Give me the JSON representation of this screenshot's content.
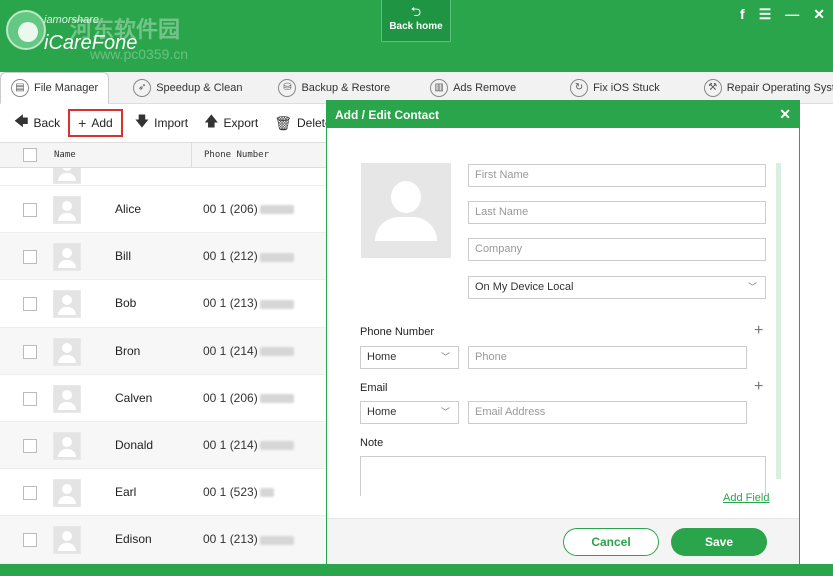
{
  "app": {
    "brand_small": "iamorshare",
    "brand_title": "iCareFone",
    "watermark": "河东软件园",
    "watermark_url": "www.pc0359.cn",
    "back_home_label": "Back home",
    "accent": "#2aa54b"
  },
  "nav": {
    "tabs": [
      {
        "label": "File Manager",
        "icon": "file-manager-icon"
      },
      {
        "label": "Speedup & Clean",
        "icon": "rocket-icon"
      },
      {
        "label": "Backup & Restore",
        "icon": "backup-icon"
      },
      {
        "label": "Ads Remove",
        "icon": "ads-icon"
      },
      {
        "label": "Fix iOS Stuck",
        "icon": "fix-icon"
      },
      {
        "label": "Repair Operating System",
        "icon": "wrench-icon"
      }
    ]
  },
  "toolbar": {
    "back": "Back",
    "add": "Add",
    "import": "Import",
    "export": "Export",
    "delete": "Delete"
  },
  "table": {
    "col_name": "Name",
    "col_phone": "Phone Number",
    "rows": [
      {
        "name": "Alice",
        "phone": "00 1 (206)"
      },
      {
        "name": "Bill",
        "phone": "00 1 (212)"
      },
      {
        "name": "Bob",
        "phone": "00 1 (213)"
      },
      {
        "name": "Bron",
        "phone": "00 1 (214)"
      },
      {
        "name": "Calven",
        "phone": "00 1 (206)"
      },
      {
        "name": "Donald",
        "phone": "00 1 (214)"
      },
      {
        "name": "Earl",
        "phone": "00 1 (523)"
      },
      {
        "name": "Edison",
        "phone": "00 1 (213)"
      }
    ]
  },
  "dialog": {
    "title": "Add / Edit Contact",
    "first_name_placeholder": "First Name",
    "last_name_placeholder": "Last Name",
    "company_placeholder": "Company",
    "account": "On My Device Local",
    "phone_label": "Phone Number",
    "phone_type": "Home",
    "phone_placeholder": "Phone",
    "email_label": "Email",
    "email_type": "Home",
    "email_placeholder": "Email Address",
    "note_label": "Note",
    "add_field": "Add Field",
    "cancel": "Cancel",
    "save": "Save"
  }
}
